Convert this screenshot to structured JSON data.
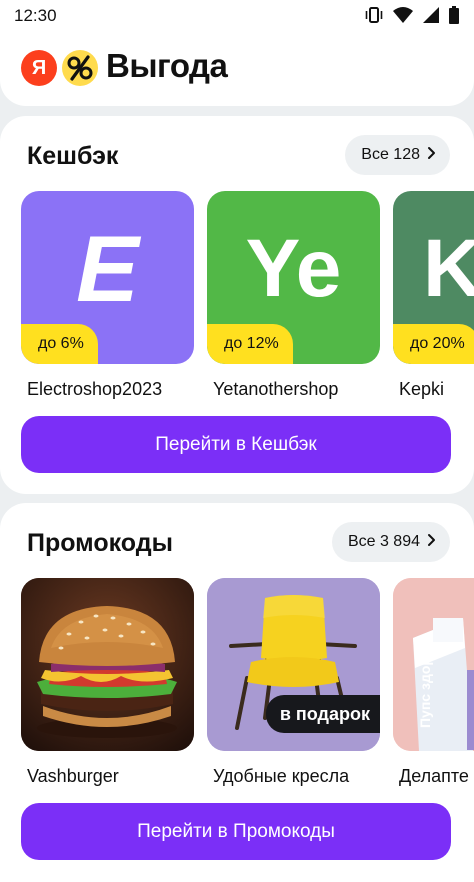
{
  "status_bar": {
    "time": "12:30",
    "icons": [
      "vibrate-icon",
      "wifi-icon",
      "signal-icon",
      "battery-icon"
    ]
  },
  "header": {
    "logo_letter": "Я",
    "title": "Выгода"
  },
  "cashback": {
    "title": "Кешбэк",
    "all_label": "Все 128",
    "items": [
      {
        "letter": "E",
        "badge": "до 6%",
        "name": "Electroshop2023",
        "color": "#8b72f6"
      },
      {
        "letter": "Ye",
        "badge": "до 12%",
        "name": "Yetanothershop",
        "color": "#52b847"
      },
      {
        "letter": "K",
        "badge": "до 20%",
        "name": "Kepki",
        "color": "#4e8a62"
      }
    ],
    "cta_label": "Перейти в Кешбэк"
  },
  "promocodes": {
    "title": "Промокоды",
    "all_label": "Все 3 894",
    "items": [
      {
        "name": "Vashburger",
        "image": "burger"
      },
      {
        "name": "Удобные кресла",
        "image": "chair",
        "badge": "в подарок"
      },
      {
        "name": "Делапте",
        "image": "supplement",
        "image_text": "Пупс здоров"
      }
    ],
    "cta_label": "Перейти в Промокоды"
  },
  "colors": {
    "accent": "#7b2ff7",
    "badge": "#ffe01f",
    "yandex_red": "#fc3f1d"
  }
}
